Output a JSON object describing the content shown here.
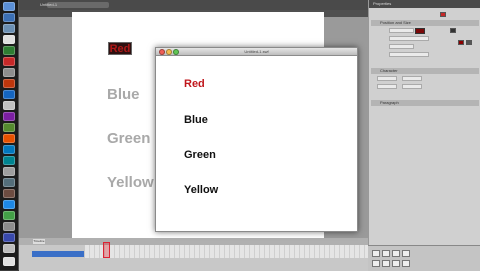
{
  "app": {
    "document_tab": "Untitled-1",
    "panel_title": "Properties",
    "timeline_tab": "Timeline"
  },
  "stage": {
    "selected_text": "Red",
    "labels": [
      "Blue",
      "Green",
      "Yellow"
    ],
    "label_color": "#a9a9a9",
    "selected_text_color": "#b01818"
  },
  "preview_window": {
    "title": "Untitled-1.swf",
    "items": [
      "Red",
      "Blue",
      "Green",
      "Yellow"
    ],
    "highlight_color": "#c0161b"
  },
  "properties": {
    "sections": [
      "Position and Size",
      "Character",
      "Paragraph"
    ],
    "text_color": "#7a0808"
  },
  "icons": {
    "dock": [
      "finder-icon",
      "browser-icon",
      "mail-icon",
      "calendar-icon",
      "photos-icon",
      "itunes-icon",
      "app-icon",
      "app-icon",
      "app-icon",
      "app-icon",
      "app-icon",
      "app-icon",
      "app-icon",
      "app-icon",
      "app-icon",
      "app-icon",
      "app-icon",
      "app-icon",
      "app-icon",
      "app-icon",
      "app-icon",
      "app-icon",
      "app-icon",
      "trash-icon"
    ]
  }
}
